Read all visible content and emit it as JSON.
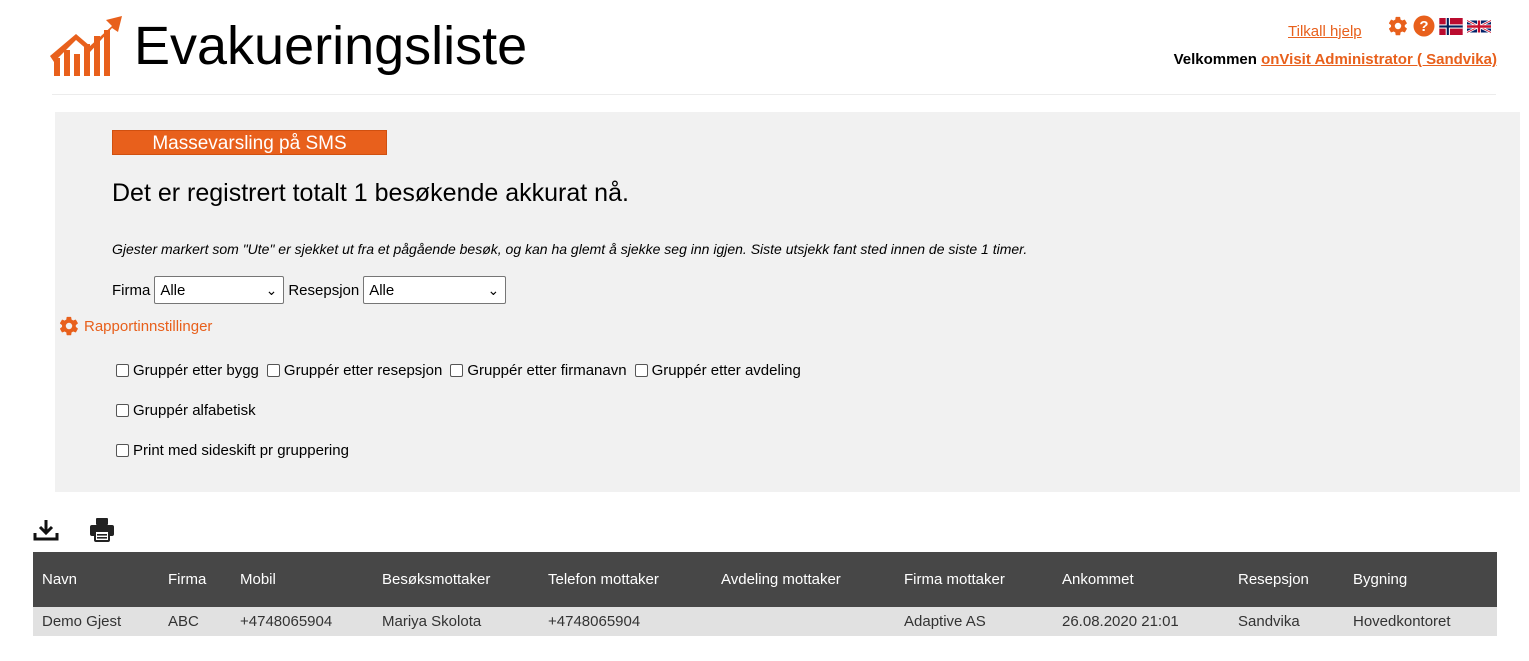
{
  "header": {
    "title": "Evakueringsliste",
    "help_link": "Tilkall hjelp",
    "welcome_label": "Velkommen",
    "user_link": "onVisit Administrator ( Sandvika)",
    "brand_color": "#e8601c"
  },
  "panel": {
    "sms_button": "Massevarsling på SMS",
    "total_text": "Det er registrert totalt 1 besøkende akkurat nå.",
    "note": "Gjester markert som \"Ute\" er sjekket ut fra et pågående besøk, og kan ha glemt å sjekke seg inn igjen. Siste utsjekk fant sted innen de siste 1 timer.",
    "filters": {
      "company_label": "Firma",
      "company_value": "Alle",
      "reception_label": "Resepsjon",
      "reception_value": "Alle"
    },
    "report_settings": "Rapportinnstillinger",
    "checkboxes": {
      "group_building": "Gruppér etter bygg",
      "group_reception": "Gruppér etter resepsjon",
      "group_company": "Gruppér etter firmanavn",
      "group_department": "Gruppér etter avdeling",
      "group_alpha": "Gruppér alfabetisk",
      "print_pagebreak": "Print med sideskift pr gruppering"
    }
  },
  "toolbar": {
    "icons": [
      "download-icon",
      "print-icon"
    ]
  },
  "table": {
    "columns": [
      "Navn",
      "Firma",
      "Mobil",
      "Besøksmottaker",
      "Telefon mottaker",
      "Avdeling mottaker",
      "Firma mottaker",
      "Ankommet",
      "Resepsjon",
      "Bygning"
    ],
    "rows": [
      [
        "Demo Gjest",
        "ABC",
        "+4748065904",
        "Mariya Skolota",
        "+4748065904",
        "",
        "Adaptive AS",
        "26.08.2020 21:01",
        "Sandvika",
        "Hovedkontoret"
      ]
    ]
  }
}
